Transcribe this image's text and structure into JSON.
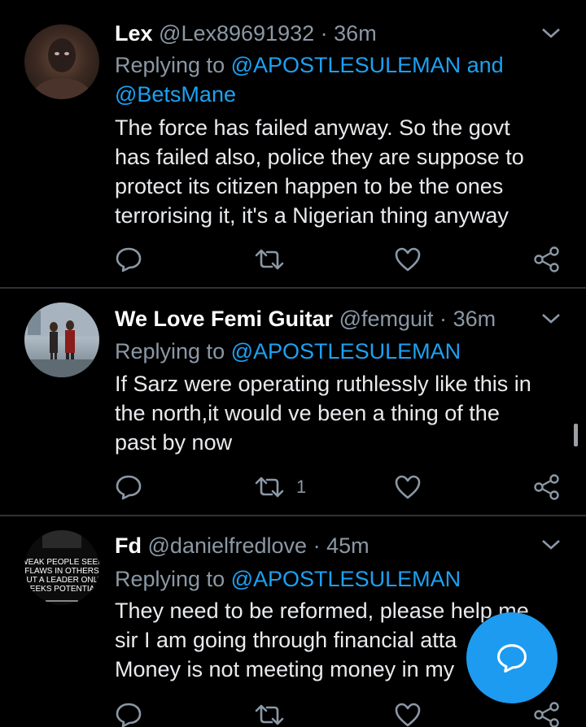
{
  "tweets": [
    {
      "name": "Lex",
      "handle": "@Lex89691932",
      "separator": "·",
      "time": "36m",
      "replying_prefix": "Replying to",
      "replying_mentions": "@APOSTLESULEMAN",
      "replying_and": "and",
      "replying_second": "@BetsMane",
      "body_lines": [
        "The force has failed anyway. So the govt",
        "has failed also, police they are suppose to",
        "protect its citizen happen to be the ones",
        "terrorising it, it's a Nigerian thing anyway"
      ],
      "retweet_count": "",
      "icons": [
        "reply-icon",
        "retweet-icon",
        "like-icon",
        "share-icon"
      ]
    },
    {
      "name": "We Love Femi Guitar",
      "handle": "@femguit",
      "separator": "·",
      "time": "36m",
      "replying_prefix": "Replying to",
      "replying_mentions": "@APOSTLESULEMAN",
      "body_lines": [
        "If Sarz were operating ruthlessly like this in",
        "the north,it would ve been a thing of the",
        "past by now"
      ],
      "retweet_count": "1",
      "icons": [
        "reply-icon",
        "retweet-icon",
        "like-icon",
        "share-icon"
      ]
    },
    {
      "name": "Fd",
      "handle": "@danielfredlove",
      "separator": "·",
      "time": "45m",
      "replying_prefix": "Replying to",
      "replying_mentions": "@APOSTLESULEMAN",
      "body_lines": [
        "They need to be reformed, please help me",
        "sir I am going through financial atta",
        "Money is not meeting money in my"
      ],
      "avatar_text": [
        "WEAK PEOPLE SEEK",
        "FLAWS IN OTHERS",
        "BUT A LEADER ONLY",
        "SEEKS POTENTIAL"
      ],
      "retweet_count": "",
      "icons": [
        "reply-icon",
        "retweet-icon",
        "like-icon",
        "share-icon"
      ]
    }
  ],
  "compose_button_icon": "compose-reply-icon",
  "colors": {
    "background": "#000000",
    "accent": "#1da1f2",
    "muted": "#8b98a5",
    "divider": "#2f3336",
    "fab": "#1d9bf0"
  }
}
